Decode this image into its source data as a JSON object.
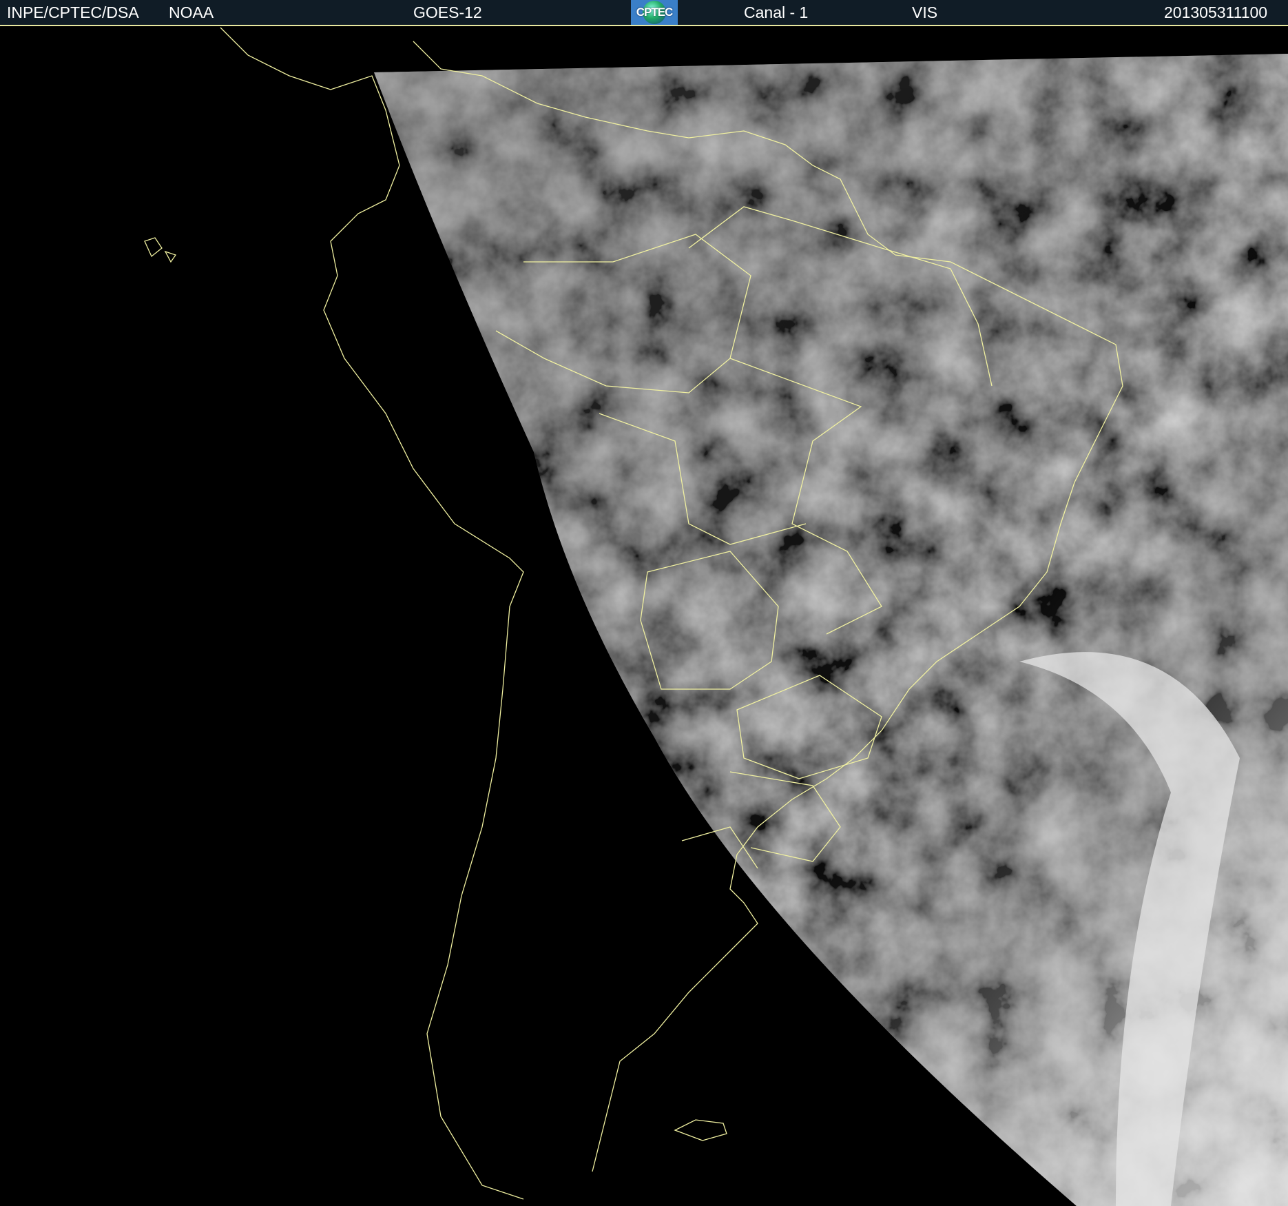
{
  "header": {
    "institution": "INPE/CPTEC/DSA",
    "agency": "NOAA",
    "satellite": "GOES-12",
    "logo_text": "CPTEC",
    "channel": "Canal - 1",
    "band": "VIS",
    "timestamp": "201305311100"
  },
  "colors": {
    "header_bg": "#101c26",
    "border_lines": "#e8e8a0",
    "space_bg": "#000000"
  }
}
